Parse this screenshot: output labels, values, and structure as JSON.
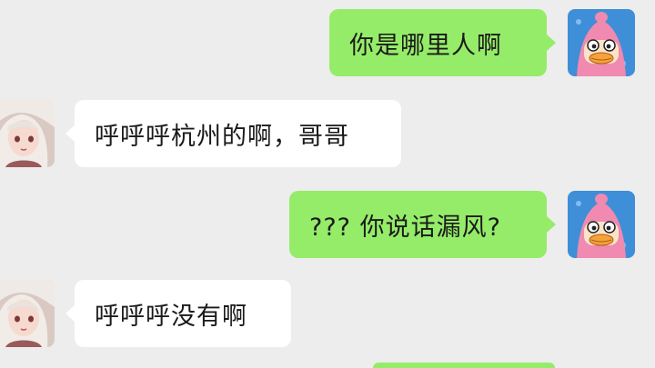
{
  "messages": [
    {
      "sender": "me",
      "text": "你是哪里人啊"
    },
    {
      "sender": "them",
      "text": "呼呼呼杭州的啊，哥哥"
    },
    {
      "sender": "me",
      "text": "??? 你说话漏风?"
    },
    {
      "sender": "them",
      "text": "呼呼呼没有啊"
    }
  ],
  "colors": {
    "background": "#ededed",
    "my_bubble": "#95ec69",
    "their_bubble": "#ffffff"
  },
  "icons": {
    "my_avatar": "pink-hooded-cartoon-avatar-icon",
    "their_avatar": "anime-girl-avatar-icon"
  }
}
